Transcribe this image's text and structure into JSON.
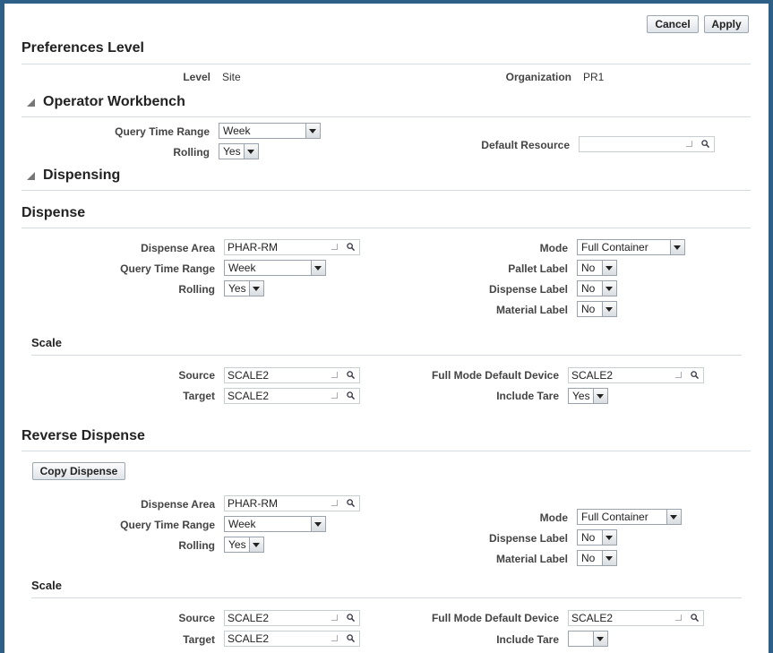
{
  "buttons": {
    "cancel": "Cancel",
    "apply": "Apply"
  },
  "preferences": {
    "title": "Preferences Level",
    "level_label": "Level",
    "level_value": "Site",
    "org_label": "Organization",
    "org_value": "PR1"
  },
  "workbench": {
    "title": "Operator Workbench",
    "query_label": "Query Time Range",
    "query_value": "Week",
    "rolling_label": "Rolling",
    "rolling_value": "Yes",
    "resource_label": "Default Resource",
    "resource_value": ""
  },
  "dispensing": {
    "title": "Dispensing"
  },
  "dispense": {
    "title": "Dispense",
    "area_label": "Dispense Area",
    "area_value": "PHAR-RM",
    "query_label": "Query Time Range",
    "query_value": "Week",
    "rolling_label": "Rolling",
    "rolling_value": "Yes",
    "mode_label": "Mode",
    "mode_value": "Full Container",
    "pallet_label": "Pallet Label",
    "pallet_value": "No",
    "dlabel_label": "Dispense Label",
    "dlabel_value": "No",
    "mlabel_label": "Material Label",
    "mlabel_value": "No",
    "scale": {
      "title": "Scale",
      "source_label": "Source",
      "source_value": "SCALE2",
      "target_label": "Target",
      "target_value": "SCALE2",
      "device_label": "Full Mode Default Device",
      "device_value": "SCALE2",
      "tare_label": "Include Tare",
      "tare_value": "Yes"
    }
  },
  "reverse": {
    "title": "Reverse Dispense",
    "copy_button": "Copy Dispense",
    "area_label": "Dispense Area",
    "area_value": "PHAR-RM",
    "query_label": "Query Time Range",
    "query_value": "Week",
    "rolling_label": "Rolling",
    "rolling_value": "Yes",
    "mode_label": "Mode",
    "mode_value": "Full Container",
    "dlabel_label": "Dispense Label",
    "dlabel_value": "No",
    "mlabel_label": "Material Label",
    "mlabel_value": "No",
    "scale": {
      "title": "Scale",
      "source_label": "Source",
      "source_value": "SCALE2",
      "target_label": "Target",
      "target_value": "SCALE2",
      "device_label": "Full Mode Default Device",
      "device_value": "SCALE2",
      "tare_label": "Include Tare",
      "tare_value": ""
    }
  }
}
